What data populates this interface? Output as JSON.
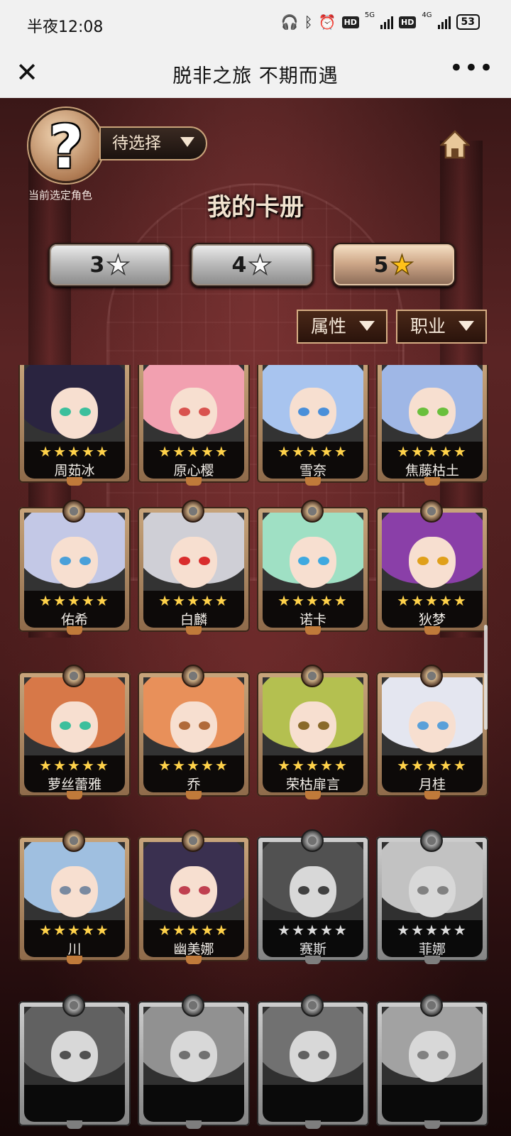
{
  "statusbar": {
    "time": "半夜12:08",
    "network_5g": "5G",
    "network_4g": "4G",
    "hd_1": "HD",
    "hd_2": "HD",
    "battery": "53"
  },
  "navbar": {
    "close_icon": "close-icon",
    "title": "脱非之旅 不期而遇",
    "more_icon": "more-icon"
  },
  "header": {
    "avatar_symbol": "?",
    "role_select_value": "待选择",
    "role_caption": "当前选定角色",
    "home_icon": "home-icon",
    "page_title": "我的卡册"
  },
  "star_tabs": [
    {
      "label": "3",
      "icon": "star-icon",
      "active": false
    },
    {
      "label": "4",
      "icon": "star-icon",
      "active": false
    },
    {
      "label": "5",
      "icon": "star-icon",
      "active": true
    }
  ],
  "filters": {
    "attribute_label": "属性",
    "job_label": "职业"
  },
  "colors": {
    "accent_gold": "#ffd24a",
    "frame_tan": "#c8a57c",
    "button_active": "#cfa98a"
  },
  "cards": [
    {
      "name": "周茹冰",
      "stars": "★★★★★",
      "rarity": 5,
      "owned": true
    },
    {
      "name": "原心樱",
      "stars": "★★★★★",
      "rarity": 5,
      "owned": true
    },
    {
      "name": "雪奈",
      "stars": "★★★★★",
      "rarity": 5,
      "owned": true
    },
    {
      "name": "焦藤枯土",
      "stars": "★★★★★",
      "rarity": 5,
      "owned": true
    },
    {
      "name": "佑希",
      "stars": "★★★★★",
      "rarity": 5,
      "owned": true
    },
    {
      "name": "白麟",
      "stars": "★★★★★",
      "rarity": 5,
      "owned": true
    },
    {
      "name": "诺卡",
      "stars": "★★★★★",
      "rarity": 5,
      "owned": true
    },
    {
      "name": "狄梦",
      "stars": "★★★★★",
      "rarity": 5,
      "owned": true
    },
    {
      "name": "萝丝蕾雅",
      "stars": "★★★★★",
      "rarity": 5,
      "owned": true
    },
    {
      "name": "乔",
      "stars": "★★★★★",
      "rarity": 5,
      "owned": true
    },
    {
      "name": "荣枯扉言",
      "stars": "★★★★★",
      "rarity": 5,
      "owned": true
    },
    {
      "name": "月桂",
      "stars": "★★★★★",
      "rarity": 5,
      "owned": true
    },
    {
      "name": "川",
      "stars": "★★★★★",
      "rarity": 5,
      "owned": true
    },
    {
      "name": "幽美娜",
      "stars": "★★★★★",
      "rarity": 5,
      "owned": true
    },
    {
      "name": "赛斯",
      "stars": "★★★★★",
      "rarity": 5,
      "owned": false
    },
    {
      "name": "菲娜",
      "stars": "★★★★★",
      "rarity": 5,
      "owned": false
    },
    {
      "name": "",
      "stars": "",
      "rarity": 5,
      "owned": false
    },
    {
      "name": "",
      "stars": "",
      "rarity": 5,
      "owned": false
    },
    {
      "name": "",
      "stars": "",
      "rarity": 5,
      "owned": false
    },
    {
      "name": "",
      "stars": "",
      "rarity": 5,
      "owned": false
    }
  ]
}
